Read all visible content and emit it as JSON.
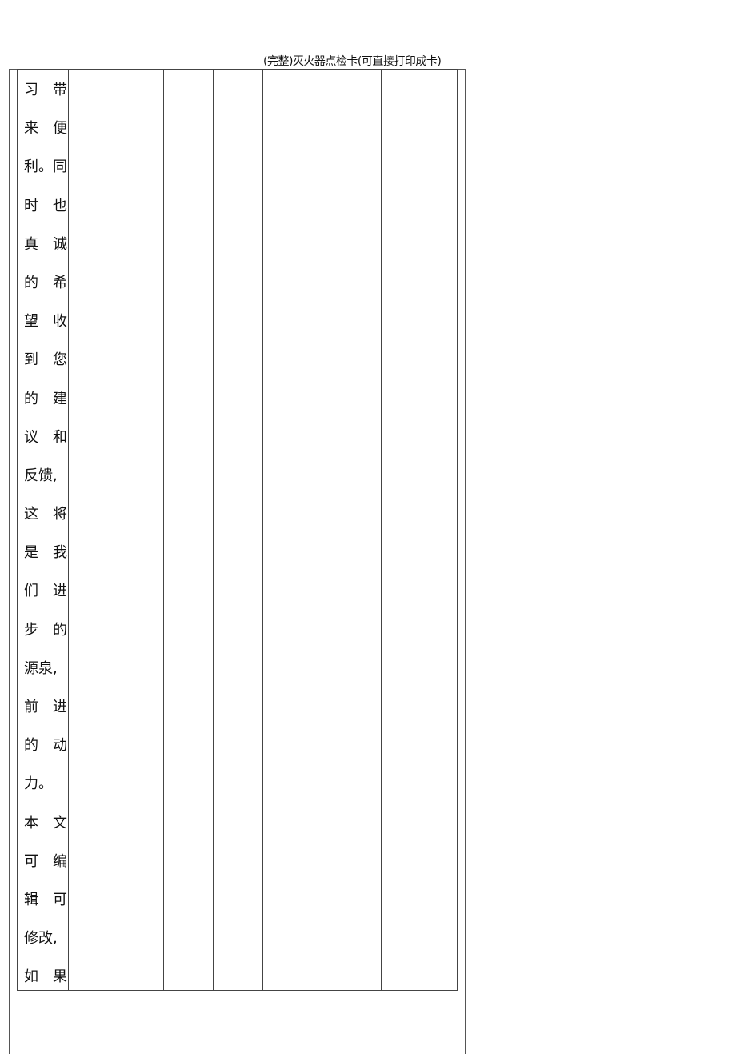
{
  "header": {
    "title": "(完整)灭火器点检卡(可直接打印成卡)"
  },
  "text_lines": [
    [
      "习",
      "带"
    ],
    [
      "来",
      "便"
    ],
    [
      "利。",
      "同"
    ],
    [
      "时",
      "也"
    ],
    [
      "真",
      "诚"
    ],
    [
      "的",
      "希"
    ],
    [
      "望",
      "收"
    ],
    [
      "到",
      "您"
    ],
    [
      "的",
      "建"
    ],
    [
      "议",
      "和"
    ],
    [
      "反馈,",
      ""
    ],
    [
      "这",
      "将"
    ],
    [
      "是",
      "我"
    ],
    [
      "们",
      "进"
    ],
    [
      "步",
      "的"
    ],
    [
      "源泉,",
      ""
    ],
    [
      "前",
      "进"
    ],
    [
      "的",
      "动"
    ],
    [
      "力。",
      ""
    ],
    [
      "本",
      "文"
    ],
    [
      "可",
      "编"
    ],
    [
      "辑",
      "可"
    ],
    [
      "修改,",
      ""
    ],
    [
      "如",
      "果"
    ]
  ]
}
